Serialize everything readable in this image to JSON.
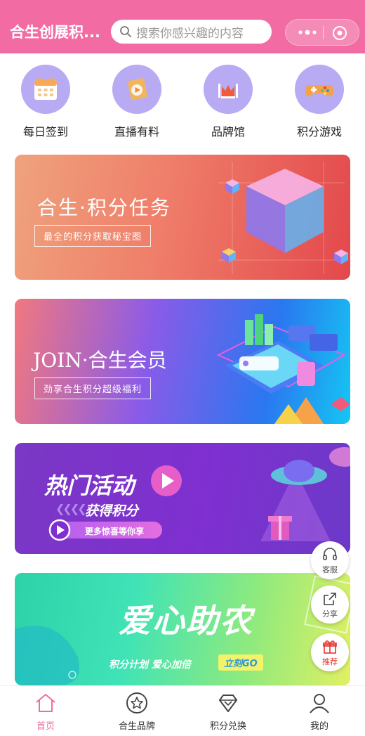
{
  "header": {
    "title": "合生创展积...",
    "search_placeholder": "搜索你感兴趣的内容"
  },
  "quick_nav": [
    {
      "label": "每日签到",
      "icon": "calendar-icon"
    },
    {
      "label": "直播有料",
      "icon": "live-play-icon"
    },
    {
      "label": "品牌馆",
      "icon": "brand-hall-icon"
    },
    {
      "label": "积分游戏",
      "icon": "gamepad-icon"
    }
  ],
  "banners": [
    {
      "title": "合生·积分任务",
      "subtitle": "最全的积分获取秘宝图"
    },
    {
      "title": "JOIN·合生会员",
      "subtitle": "劲享合生积分超级福利"
    },
    {
      "title": "热门活动",
      "subtitle": "获得积分",
      "tag": "更多惊喜等你享"
    },
    {
      "title": "爱心助农",
      "subtitle": "积分计划 爱心加倍",
      "tag": "立刻GO"
    }
  ],
  "floating": {
    "service": "客服",
    "share": "分享",
    "recommend": "推荐"
  },
  "tabbar": [
    {
      "label": "首页",
      "icon": "home-icon",
      "active": true
    },
    {
      "label": "合生品牌",
      "icon": "star-icon",
      "active": false
    },
    {
      "label": "积分兑换",
      "icon": "diamond-icon",
      "active": false
    },
    {
      "label": "我的",
      "icon": "user-icon",
      "active": false
    }
  ],
  "colors": {
    "brand": "#f26ca3",
    "quick_nav_circle": "#b8aaf3"
  }
}
